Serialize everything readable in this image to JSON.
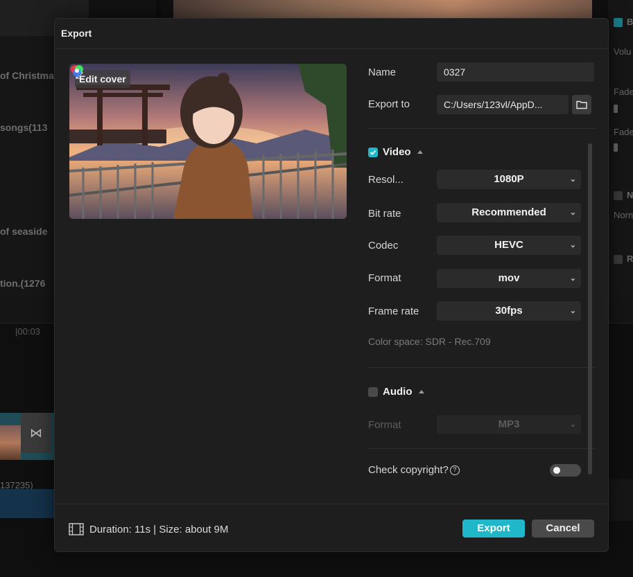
{
  "background": {
    "media_items": [
      "of Christma",
      "songs(113",
      "of seaside",
      "tion.(1276"
    ],
    "timeline_time": "|00:03",
    "audio_clip_label": "137235)",
    "right_panel": {
      "row1": "B",
      "row2": "Volu",
      "row3": "Fade",
      "row4": "Fade",
      "row5": "N",
      "row6": "Norn",
      "row7": "R"
    },
    "transition_glyph": "⋈"
  },
  "dialog": {
    "title": "Export",
    "edit_cover_label": "Edit cover",
    "name_label": "Name",
    "name_value": "0327",
    "export_to_label": "Export to",
    "export_to_value": "C:/Users/123vl/AppD...",
    "video": {
      "section_label": "Video",
      "enabled": true,
      "resolution_label": "Resol...",
      "resolution_value": "1080P",
      "bitrate_label": "Bit rate",
      "bitrate_value": "Recommended",
      "codec_label": "Codec",
      "codec_value": "HEVC",
      "format_label": "Format",
      "format_value": "mov",
      "framerate_label": "Frame rate",
      "framerate_value": "30fps",
      "color_space": "Color space: SDR - Rec.709"
    },
    "audio": {
      "section_label": "Audio",
      "enabled": false,
      "format_label": "Format",
      "format_value": "MP3"
    },
    "copyright_label": "Check copyright?",
    "copyright_help": "?",
    "copyright_enabled": false,
    "footer_info": "Duration: 11s | Size: about 9M",
    "export_button": "Export",
    "cancel_button": "Cancel"
  },
  "icons": {
    "edit": "pencil-icon",
    "folder": "folder-icon",
    "film": "film-icon",
    "chevron": "chevron-down-icon",
    "help": "question-circle-icon",
    "color": "color-wheel-icon"
  },
  "colors": {
    "accent": "#1fb7c9",
    "dialog_bg": "#1e1e1e",
    "field_bg": "#2b2b2b"
  }
}
